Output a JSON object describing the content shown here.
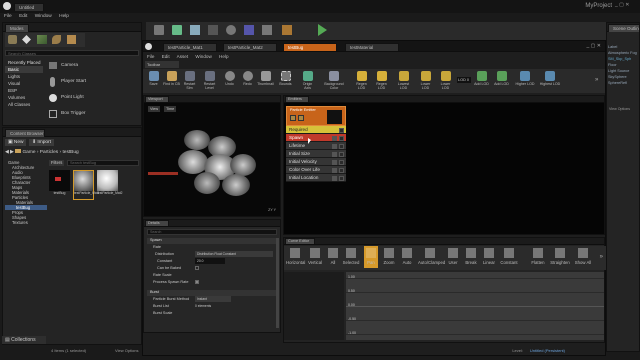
{
  "colors": {
    "accent_orange": "#c8641a",
    "red": "#c0392b",
    "yellow": "#d6c23a"
  },
  "main_window": {
    "tab": "Untitled",
    "project": "MyProject",
    "menu": [
      "File",
      "Edit",
      "Window",
      "Help"
    ]
  },
  "modes_panel": {
    "title": "Modes",
    "search_placeholder": "Search Classes",
    "categories": [
      "Recently Placed",
      "Basic",
      "Lights",
      "Visual",
      "BSP",
      "Volumes",
      "All Classes"
    ],
    "items": [
      "Camera",
      "Player Start",
      "Point Light",
      "Box Trigger"
    ]
  },
  "scene_outliner": {
    "title": "Scene Outliner",
    "items": [
      "Label",
      "Atmospheric Fog",
      "SM_Skp_Sph",
      "Floor",
      "Light Source",
      "SkySphere",
      "SphereRefl"
    ],
    "view_options": "View Options"
  },
  "content_browser": {
    "title": "Content Browser",
    "new_label": "New",
    "import_label": "Import",
    "breadcrumb": [
      "Game",
      "Particles",
      "testBug"
    ],
    "filters_label": "Filters",
    "search_placeholder": "Search testBug",
    "tree": [
      "Game",
      "Architecture",
      "Audio",
      "Blueprints",
      "Character",
      "Maps",
      "Materials",
      "Particles",
      "Materials",
      "testBug",
      "Props",
      "Shapes",
      "Textures"
    ],
    "assets": [
      "testBug",
      "testParticle_Mat1",
      "testParticle_Mat2"
    ],
    "status": "4 Items (1 selected)",
    "view_options": "View Options",
    "collections_label": "Collections"
  },
  "cascade": {
    "tabs": [
      "testParticle_Mat1",
      "testParticle_Mat2",
      "testBug",
      "testMaterial"
    ],
    "menu": [
      "File",
      "Edit",
      "Asset",
      "Window",
      "Help"
    ],
    "toolbar": [
      {
        "label": "Save",
        "icon": "save-icon"
      },
      {
        "label": "Find in CB",
        "icon": "find-icon"
      },
      {
        "label": "Restart Sim",
        "icon": "restart-icon"
      },
      {
        "label": "Restart Level",
        "icon": "restart-level-icon"
      },
      {
        "label": "Undo",
        "icon": "undo-icon"
      },
      {
        "label": "Redo",
        "icon": "redo-icon"
      },
      {
        "label": "Thumbnail",
        "icon": "thumbnail-icon"
      },
      {
        "label": "Bounds",
        "icon": "bounds-icon"
      },
      {
        "label": "Origin Axis",
        "icon": "axis-icon"
      },
      {
        "label": "Background Color",
        "icon": "color-icon"
      },
      {
        "label": "Regen LOD",
        "icon": "regen-icon"
      },
      {
        "label": "Regen LOD",
        "icon": "regen-icon"
      },
      {
        "label": "Lowest LOD",
        "icon": "lowest-icon"
      },
      {
        "label": "Lower LOD",
        "icon": "lower-icon"
      },
      {
        "label": "Lower LOD",
        "icon": "lower-icon"
      },
      {
        "label": "Add LOD",
        "icon": "add-icon"
      },
      {
        "label": "Add LOD",
        "icon": "add-icon"
      },
      {
        "label": "Higher LOD",
        "icon": "higher-icon"
      },
      {
        "label": "Highest LOD",
        "icon": "highest-icon"
      }
    ],
    "lod_value": "LOD 0",
    "viewport": {
      "title": "Viewport",
      "view_btn": "View",
      "time_btn": "Time",
      "axis_label": "ZY Y"
    },
    "emitters": {
      "title": "Emitters",
      "emitter_name": "Particle Emitter",
      "modules": [
        "Required",
        "Spawn",
        "Lifetime",
        "Initial Size",
        "Initial Velocity",
        "Color Over Life",
        "Initial Location"
      ]
    },
    "details": {
      "title": "Details",
      "search_placeholder": "Search",
      "sections": [
        {
          "name": "Spawn",
          "props": [
            {
              "label": "Rate",
              "value": ""
            },
            {
              "label": "Distribution",
              "value": "Distribution Float Constant"
            },
            {
              "label": "Constant",
              "value": "20.0"
            },
            {
              "label": "Can be Baked",
              "value": ""
            },
            {
              "label": "Rate Scale",
              "value": ""
            },
            {
              "label": "Process Spawn Rate",
              "value": ""
            }
          ]
        },
        {
          "name": "Burst",
          "props": [
            {
              "label": "Particle Burst Method",
              "value": "Instant"
            },
            {
              "label": "Burst List",
              "value": "0 elements"
            },
            {
              "label": "Burst Scale",
              "value": ""
            }
          ]
        }
      ]
    },
    "curve_editor": {
      "title": "Curve Editor",
      "tools": [
        "Horizontal",
        "Vertical",
        "All",
        "Selected",
        "Pan",
        "Zoom",
        "Auto",
        "Auto/Clamped",
        "User",
        "Break",
        "Linear",
        "Constant",
        "Flatten",
        "Straighten",
        "Show All"
      ],
      "y_labels": [
        "1.00",
        "0.50",
        "0.00",
        "-0.50",
        "-1.00"
      ]
    },
    "status": {
      "level": "Level:",
      "level_value": "Untitled (Persistent)"
    }
  }
}
